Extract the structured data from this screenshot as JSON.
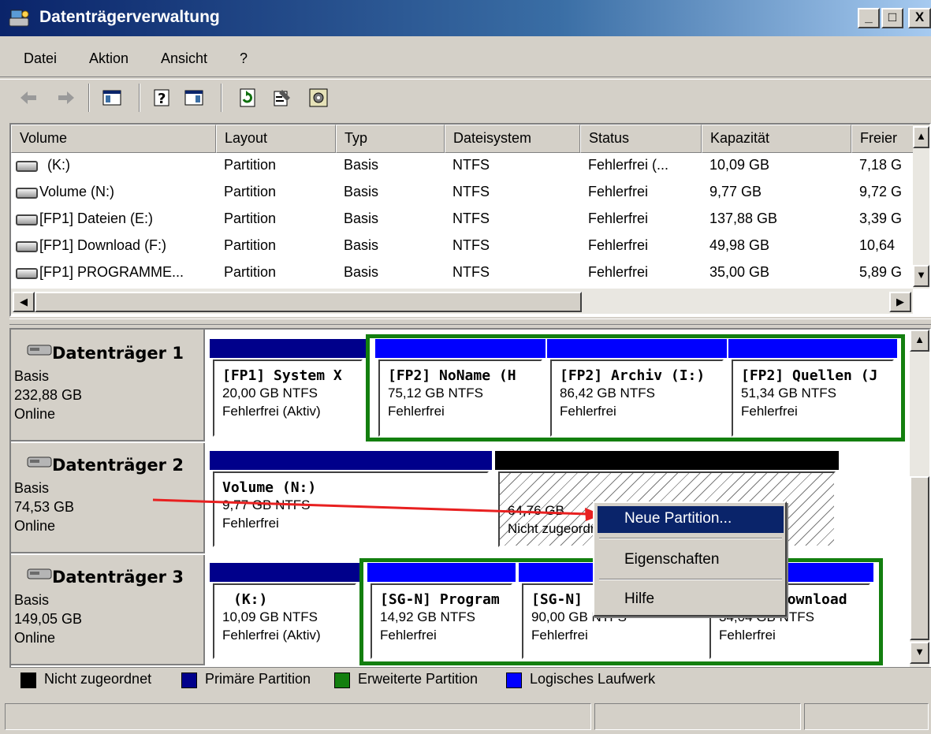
{
  "window": {
    "title": "Datenträgerverwaltung",
    "minimize": "_",
    "maximize": "□",
    "close": "X"
  },
  "menu": [
    "Datei",
    "Aktion",
    "Ansicht",
    "?"
  ],
  "toolbar": [
    "back-icon",
    "forward-icon",
    "console-tree-icon",
    "help-icon",
    "panel-icon",
    "refresh-icon",
    "properties-icon",
    "rescan-icon"
  ],
  "volume_list": {
    "columns": [
      "Volume",
      "Layout",
      "Typ",
      "Dateisystem",
      "Status",
      "Kapazität",
      "Freier"
    ],
    "rows": [
      [
        "(K:)",
        "Partition",
        "Basis",
        "NTFS",
        "Fehlerfrei (...",
        "10,09 GB",
        "7,18 G"
      ],
      [
        "Volume (N:)",
        "Partition",
        "Basis",
        "NTFS",
        "Fehlerfrei",
        "9,77 GB",
        "9,72 G"
      ],
      [
        "[FP1] Dateien (E:)",
        "Partition",
        "Basis",
        "NTFS",
        "Fehlerfrei",
        "137,88 GB",
        "3,39 G"
      ],
      [
        "[FP1] Download (F:)",
        "Partition",
        "Basis",
        "NTFS",
        "Fehlerfrei",
        "49,98 GB",
        "10,64"
      ],
      [
        "[FP1] PROGRAMME...",
        "Partition",
        "Basis",
        "NTFS",
        "Fehlerfrei",
        "35,00 GB",
        "5,89 G"
      ]
    ]
  },
  "disks": [
    {
      "name": "Datenträger 1",
      "type": "Basis",
      "size": "232,88 GB",
      "state": "Online",
      "partitions": [
        {
          "name": "[FP1] System X",
          "line2": "20,00 GB NTFS",
          "line3": "Fehlerfrei (Aktiv)"
        },
        {
          "name": "[FP2] NoName  (H",
          "line2": "75,12 GB NTFS",
          "line3": "Fehlerfrei"
        },
        {
          "name": "[FP2] Archiv  (I:)",
          "line2": "86,42 GB NTFS",
          "line3": "Fehlerfrei"
        },
        {
          "name": "[FP2] Quellen  (J",
          "line2": "51,34 GB NTFS",
          "line3": "Fehlerfrei"
        }
      ]
    },
    {
      "name": "Datenträger 2",
      "type": "Basis",
      "size": "74,53 GB",
      "state": "Online",
      "partitions": [
        {
          "name": "Volume  (N:)",
          "line2": "9,77 GB NTFS",
          "line3": "Fehlerfrei"
        },
        {
          "name": "",
          "line2": "64,76 GB",
          "line3": "Nicht zugeordnet"
        }
      ]
    },
    {
      "name": "Datenträger 3",
      "type": "Basis",
      "size": "149,05 GB",
      "state": "Online",
      "partitions": [
        {
          "name": "(K:)",
          "line2": "10,09 GB NTFS",
          "line3": "Fehlerfrei (Aktiv)"
        },
        {
          "name": "[SG-N] Program",
          "line2": "14,92 GB NTFS",
          "line3": "Fehlerfrei"
        },
        {
          "name": "[SG-N] ",
          "line2": "90,00 GB NTFS",
          "line3": "Fehlerfrei"
        },
        {
          "name": "[SG-N] Download",
          "line2": "34,04 GB NTFS",
          "line3": "Fehlerfrei"
        }
      ]
    }
  ],
  "legend": [
    "Nicht zugeordnet",
    "Primäre Partition",
    "Erweiterte Partition",
    "Logisches Laufwerk"
  ],
  "colors": {
    "unallocated": "#000000",
    "primary": "#00008b",
    "extended": "#137f0f",
    "logical": "#0000ff",
    "annotation_arrow": "#e82020"
  },
  "context_menu": [
    "Neue Partition...",
    "Eigenschaften",
    "Hilfe"
  ]
}
